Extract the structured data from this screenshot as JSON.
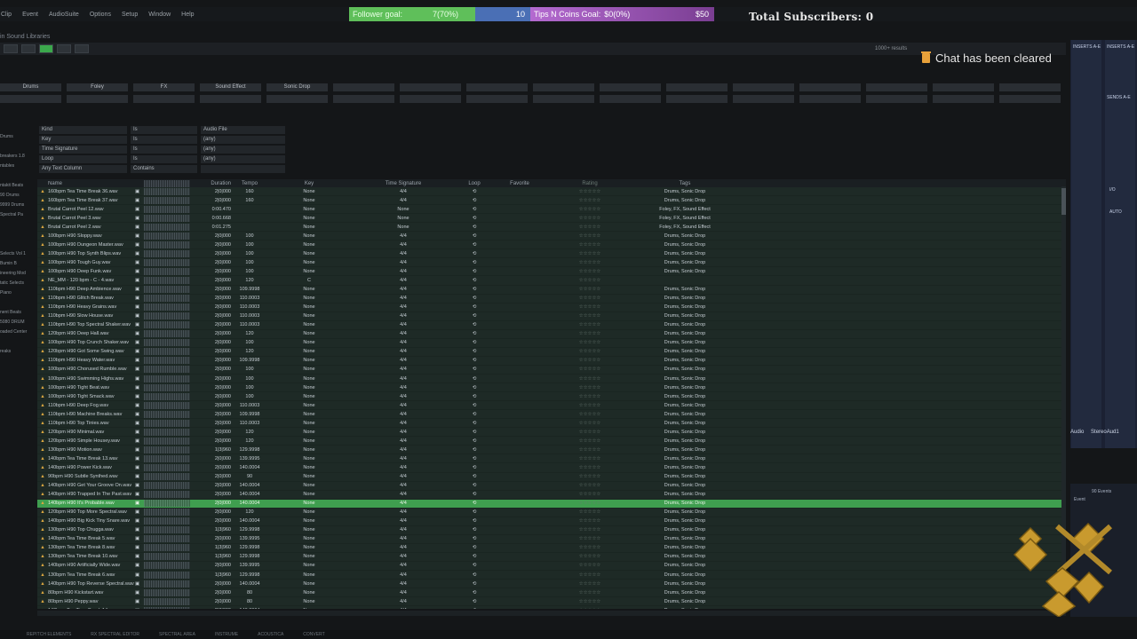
{
  "menu": [
    "Clip",
    "Event",
    "AudioSuite",
    "Options",
    "Setup",
    "Window",
    "Help"
  ],
  "overlay": {
    "follower_label": "Follower goal:",
    "follower_value": "7(70%)",
    "follower_target": "10",
    "tips_label": "Tips N Coins Goal:",
    "tips_value": "$0(0%)",
    "tips_target": "$50",
    "subscribers": "Total Subscribers: 0",
    "chat_status": "Chat has been cleared"
  },
  "library_title": "in Sound Libraries",
  "results": "1000+ results",
  "categories": [
    "Drums",
    "Foley",
    "FX",
    "Sound Effect",
    "Sonic Drop",
    "",
    "",
    "",
    "",
    "",
    "",
    "",
    "",
    "",
    "",
    ""
  ],
  "filters": [
    {
      "field": "Kind",
      "op": "Is",
      "value": "Audio File"
    },
    {
      "field": "Key",
      "op": "Is",
      "value": "(any)"
    },
    {
      "field": "Time Signature",
      "op": "Is",
      "value": "(any)"
    },
    {
      "field": "Loop",
      "op": "Is",
      "value": "(any)"
    },
    {
      "field": "Any Text Column",
      "op": "Contains",
      "value": ""
    }
  ],
  "left_items": [
    "",
    "Drums",
    "",
    "breakers 1.8",
    "ntables",
    "",
    "ntakit Beats",
    "90 Drums",
    "9999 Drums",
    "Spectral Pa",
    "",
    "",
    "",
    "Selects Vol 1",
    "Bumin B",
    "ineering Mod",
    "tatic Selects",
    "Piano",
    "",
    "nent Beats",
    "5080 DRUM",
    "oaded Center",
    "",
    "reaks"
  ],
  "columns": [
    "",
    "Name",
    "",
    "",
    "Duration",
    "Tempo",
    "Key",
    "Time Signature",
    "Loop",
    "Favorite",
    "Rating",
    "Tags"
  ],
  "rows": [
    [
      "160bpm Tea Time Break 36.wav",
      "2|0|000",
      "160",
      "None",
      "4/4",
      "Drums, Sonic Drop"
    ],
    [
      "160bpm Tea Time Break 37.wav",
      "2|0|000",
      "160",
      "None",
      "4/4",
      "Drums, Sonic Drop"
    ],
    [
      "Brutal Carrot Peel 12.wav",
      "0:00.470",
      "",
      "None",
      "None",
      "Foley, FX, Sound Effect"
    ],
    [
      "Brutal Carrot Peel 3.wav",
      "0:00.668",
      "",
      "None",
      "None",
      "Foley, FX, Sound Effect"
    ],
    [
      "Brutal Carrot Peel 2.wav",
      "0:01.275",
      "",
      "None",
      "None",
      "Foley, FX, Sound Effect"
    ],
    [
      "100bpm H90 Sloppy.wav",
      "2|0|000",
      "100",
      "None",
      "4/4",
      "Drums, Sonic Drop"
    ],
    [
      "100bpm H90 Dungeon Master.wav",
      "2|0|000",
      "100",
      "None",
      "4/4",
      "Drums, Sonic Drop"
    ],
    [
      "100bpm H90 Top Synth Blips.wav",
      "2|0|000",
      "100",
      "None",
      "4/4",
      "Drums, Sonic Drop"
    ],
    [
      "100bpm H90 Tough Guy.wav",
      "2|0|000",
      "100",
      "None",
      "4/4",
      "Drums, Sonic Drop"
    ],
    [
      "100bpm H90 Deep Funk.wav",
      "2|0|000",
      "100",
      "None",
      "4/4",
      "Drums, Sonic Drop"
    ],
    [
      "NE_MM - 120 bpm - C - 4.wav",
      "2|0|000",
      "120",
      "C",
      "4/4",
      ""
    ],
    [
      "110bpm H90 Deep Ambience.wav",
      "2|0|000",
      "109.9998",
      "None",
      "4/4",
      "Drums, Sonic Drop"
    ],
    [
      "110bpm H90 Glitch Break.wav",
      "2|0|000",
      "110.0003",
      "None",
      "4/4",
      "Drums, Sonic Drop"
    ],
    [
      "110bpm H90 Heavy Grains.wav",
      "2|0|000",
      "110.0003",
      "None",
      "4/4",
      "Drums, Sonic Drop"
    ],
    [
      "110bpm H90 Slow House.wav",
      "2|0|000",
      "110.0003",
      "None",
      "4/4",
      "Drums, Sonic Drop"
    ],
    [
      "110bpm H90 Top Spectral Shaker.wav",
      "2|0|000",
      "110.0003",
      "None",
      "4/4",
      "Drums, Sonic Drop"
    ],
    [
      "120bpm H90 Deep Hall.wav",
      "2|0|000",
      "120",
      "None",
      "4/4",
      "Drums, Sonic Drop"
    ],
    [
      "100bpm H90 Top Crunch Shaker.wav",
      "2|0|000",
      "100",
      "None",
      "4/4",
      "Drums, Sonic Drop"
    ],
    [
      "120bpm H90 Got Some Swing.wav",
      "2|0|000",
      "120",
      "None",
      "4/4",
      "Drums, Sonic Drop"
    ],
    [
      "110bpm H90 Heavy Water.wav",
      "2|0|000",
      "109.9998",
      "None",
      "4/4",
      "Drums, Sonic Drop"
    ],
    [
      "100bpm H90 Chorused Rumble.wav",
      "2|0|000",
      "100",
      "None",
      "4/4",
      "Drums, Sonic Drop"
    ],
    [
      "100bpm H90 Swimming Highs.wav",
      "2|0|000",
      "100",
      "None",
      "4/4",
      "Drums, Sonic Drop"
    ],
    [
      "100bpm H90 Tight Beat.wav",
      "2|0|000",
      "100",
      "None",
      "4/4",
      "Drums, Sonic Drop"
    ],
    [
      "100bpm H90 Tight Smack.wav",
      "2|0|000",
      "100",
      "None",
      "4/4",
      "Drums, Sonic Drop"
    ],
    [
      "110bpm H90 Deep Fog.wav",
      "2|0|000",
      "110.0003",
      "None",
      "4/4",
      "Drums, Sonic Drop"
    ],
    [
      "110bpm H90 Machine Breaks.wav",
      "2|0|000",
      "109.9998",
      "None",
      "4/4",
      "Drums, Sonic Drop"
    ],
    [
      "110bpm H90 Top Tinies.wav",
      "2|0|000",
      "110.0003",
      "None",
      "4/4",
      "Drums, Sonic Drop"
    ],
    [
      "120bpm H90 Minimal.wav",
      "2|0|000",
      "120",
      "None",
      "4/4",
      "Drums, Sonic Drop"
    ],
    [
      "120bpm H90 Simple Housey.wav",
      "2|0|000",
      "120",
      "None",
      "4/4",
      "Drums, Sonic Drop"
    ],
    [
      "130bpm H90 Motion.wav",
      "1|3|960",
      "129.9998",
      "None",
      "4/4",
      "Drums, Sonic Drop"
    ],
    [
      "140bpm Tea Time Break 13.wav",
      "2|0|000",
      "139.9995",
      "None",
      "4/4",
      "Drums, Sonic Drop"
    ],
    [
      "140bpm H90 Power Kick.wav",
      "2|0|000",
      "140.0004",
      "None",
      "4/4",
      "Drums, Sonic Drop"
    ],
    [
      "90bpm H90 Subtle Synthed.wav",
      "2|0|000",
      "90",
      "None",
      "4/4",
      "Drums, Sonic Drop"
    ],
    [
      "140bpm H90 Get Your Groove On.wav",
      "2|0|000",
      "140.0004",
      "None",
      "4/4",
      "Drums, Sonic Drop"
    ],
    [
      "140bpm H90 Trapped In The Past.wav",
      "2|0|000",
      "140.0004",
      "None",
      "4/4",
      "Drums, Sonic Drop"
    ],
    [
      "140bpm H90 It's Probable.wav",
      "2|0|000",
      "140.0004",
      "None",
      "4/4",
      "Drums, Sonic Drop"
    ],
    [
      "120bpm H90 Top More Spectral.wav",
      "2|0|000",
      "120",
      "None",
      "4/4",
      "Drums, Sonic Drop"
    ],
    [
      "140bpm H90 Big Kick Tiny Snare.wav",
      "2|0|000",
      "140.0004",
      "None",
      "4/4",
      "Drums, Sonic Drop"
    ],
    [
      "130bpm H90 Top Chugga.wav",
      "1|3|960",
      "129.9998",
      "None",
      "4/4",
      "Drums, Sonic Drop"
    ],
    [
      "140bpm Tea Time Break 5.wav",
      "2|0|000",
      "139.9995",
      "None",
      "4/4",
      "Drums, Sonic Drop"
    ],
    [
      "130bpm Tea Time Break 8.wav",
      "1|3|960",
      "129.9998",
      "None",
      "4/4",
      "Drums, Sonic Drop"
    ],
    [
      "130bpm Tea Time Break 10.wav",
      "1|3|960",
      "129.9998",
      "None",
      "4/4",
      "Drums, Sonic Drop"
    ],
    [
      "140bpm H90 Artificially Wide.wav",
      "2|0|000",
      "139.9995",
      "None",
      "4/4",
      "Drums, Sonic Drop"
    ],
    [
      "130bpm Tea Time Break 6.wav",
      "1|3|960",
      "129.9998",
      "None",
      "4/4",
      "Drums, Sonic Drop"
    ],
    [
      "140bpm H90 Top Reverse Spectral.wav",
      "2|0|000",
      "140.0004",
      "None",
      "4/4",
      "Drums, Sonic Drop"
    ],
    [
      "80bpm H90 Kickstart.wav",
      "2|0|000",
      "80",
      "None",
      "4/4",
      "Drums, Sonic Drop"
    ],
    [
      "80bpm H90 Peppy.wav",
      "2|0|000",
      "80",
      "None",
      "4/4",
      "Drums, Sonic Drop"
    ],
    [
      "140bpm Tea Time Break 14.wav",
      "2|0|000",
      "140.0004",
      "None",
      "4/4",
      "Drums, Sonic Drop"
    ],
    [
      "80bpm H90 Stretched.wav",
      "2|0|000",
      "80",
      "None",
      "4/4",
      "Drums, Sonic Drop"
    ],
    [
      "140bpm Tea Time Break 15.wav",
      "2|0|000",
      "139.9995",
      "None",
      "4/4",
      "Drums, Sonic Drop"
    ],
    [
      "140bpm Tea Time Break 16.wav",
      "2|0|000",
      "139.9995",
      "None",
      "4/4",
      "Drums, Sonic Drop"
    ],
    [
      "130bpm Tea Time Break 4.wav",
      "1|3|960",
      "130.0006",
      "None",
      "4/4",
      "Drums, Sonic Drop"
    ],
    [
      "130bpm H90 Wobly Works.wav",
      "2|0|000",
      "130",
      "None",
      "4/4",
      "Drums, Sonic Drop"
    ]
  ],
  "selected_row": 35,
  "right_panel": {
    "inserts": "INSERTS A-E",
    "sends": "SENDS A-E",
    "io": "I/O",
    "auto": "AUTO",
    "track1": "Audio",
    "track2": "StereoAud1"
  },
  "events_panel": {
    "title": "90 Events",
    "header": "Event"
  },
  "bottom_tabs": [
    "REPITCH ELEMENTS",
    "RX SPECTRAL EDITOR",
    "SPECTRAL AREA",
    "INSTRUME",
    "ACOUSTICA",
    "CONVERT"
  ],
  "colors": {
    "follower": "#5fbf5a",
    "tips": "#b46ad0",
    "selected": "#3f9e4f"
  }
}
